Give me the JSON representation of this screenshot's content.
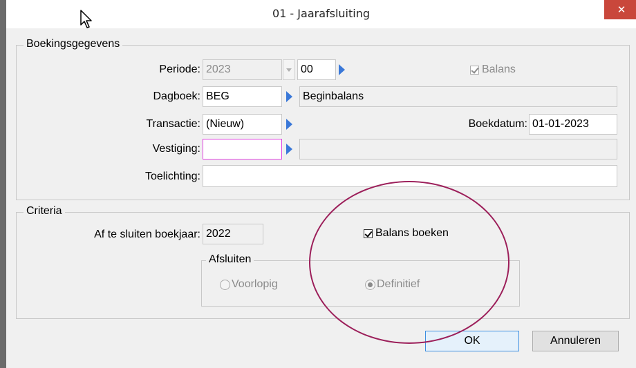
{
  "window": {
    "title": "01 - Jaarafsluiting",
    "close_label": "✕"
  },
  "boekingsgegevens": {
    "legend": "Boekingsgegevens",
    "periode_label": "Periode:",
    "periode_jaar": "2023",
    "periode_nummer": "00",
    "balans_label": "Balans",
    "balans_checked": true,
    "dagboek_label": "Dagboek:",
    "dagboek_code": "BEG",
    "dagboek_naam": "Beginbalans",
    "transactie_label": "Transactie:",
    "transactie_value": "(Nieuw)",
    "boekdatum_label": "Boekdatum:",
    "boekdatum_value": "01-01-2023",
    "vestiging_label": "Vestiging:",
    "vestiging_code": "",
    "vestiging_naam": "",
    "toelichting_label": "Toelichting:",
    "toelichting_value": ""
  },
  "criteria": {
    "legend": "Criteria",
    "boekjaar_label": "Af te sluiten boekjaar:",
    "boekjaar_value": "2022",
    "balans_boeken_label": "Balans boeken",
    "balans_boeken_checked": true,
    "afsluiten": {
      "legend": "Afsluiten",
      "options": [
        {
          "label": "Voorlopig",
          "selected": false
        },
        {
          "label": "Definitief",
          "selected": true
        }
      ]
    }
  },
  "buttons": {
    "ok_label": "OK",
    "cancel_label": "Annuleren"
  },
  "colors": {
    "accent_arrow": "#3a78d8",
    "close_button": "#c9473b",
    "annotation_circle": "#9c1f5a",
    "focus_border": "#e040e0"
  }
}
